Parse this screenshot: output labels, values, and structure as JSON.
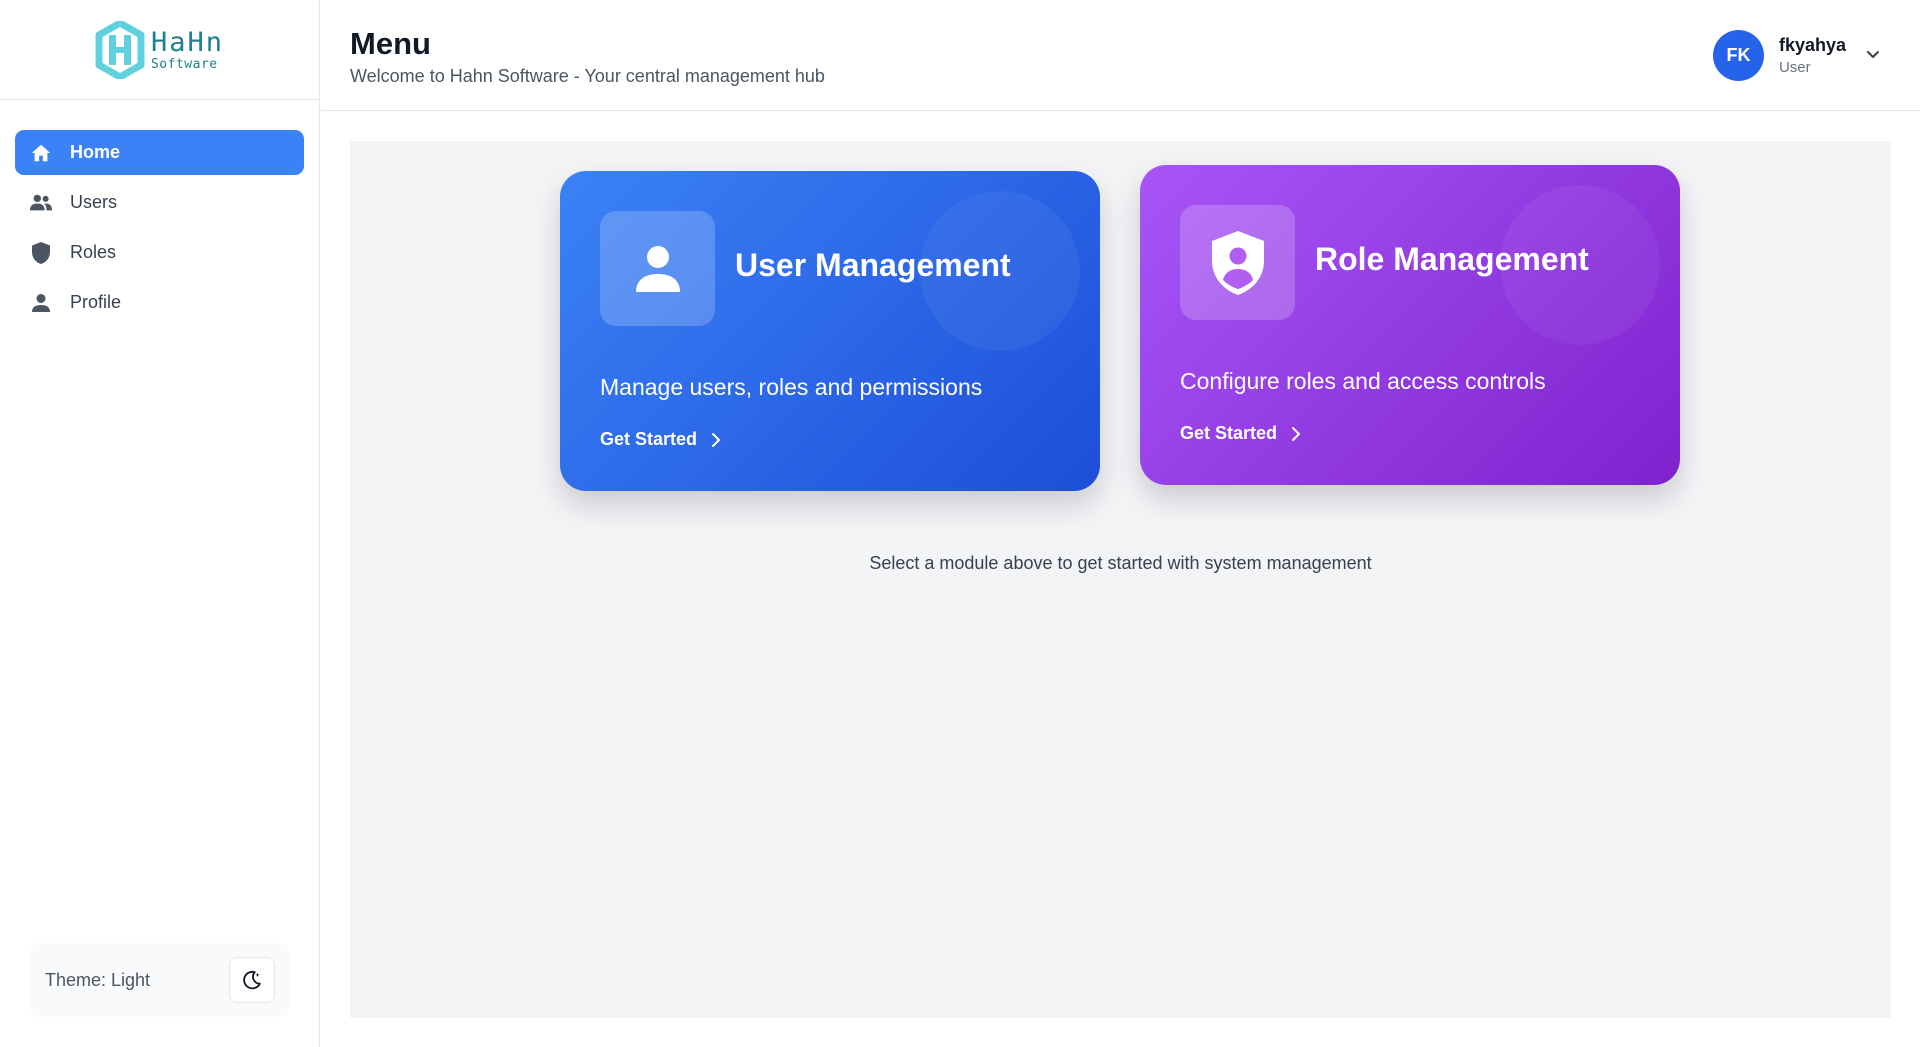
{
  "app": {
    "logo": {
      "line1": "HaHn",
      "line2": "Software"
    }
  },
  "sidebar": {
    "items": [
      {
        "label": "Home",
        "icon": "home-icon",
        "active": true
      },
      {
        "label": "Users",
        "icon": "users-icon",
        "active": false
      },
      {
        "label": "Roles",
        "icon": "shield-icon",
        "active": false
      },
      {
        "label": "Profile",
        "icon": "person-icon",
        "active": false
      }
    ],
    "theme": {
      "label": "Theme: Light",
      "toggle_icon": "moon-icon"
    }
  },
  "header": {
    "title": "Menu",
    "subtitle": "Welcome to Hahn Software - Your central management hub",
    "user": {
      "initials": "FK",
      "name": "fkyahya",
      "role": "User"
    }
  },
  "main": {
    "cards": [
      {
        "title": "User Management",
        "description": "Manage users, roles and permissions",
        "cta": "Get Started",
        "icon": "user-icon",
        "color_from": "#3b82f6",
        "color_to": "#1d4ed8"
      },
      {
        "title": "Role Management",
        "description": "Configure roles and access controls",
        "cta": "Get Started",
        "icon": "shield-user-icon",
        "color_from": "#a855f7",
        "color_to": "#7e22ce"
      }
    ],
    "hint": "Select a module above to get started with system management"
  },
  "colors": {
    "accent": "#3b82f6",
    "avatar": "#2563eb",
    "brand": "#1f7f8f"
  }
}
